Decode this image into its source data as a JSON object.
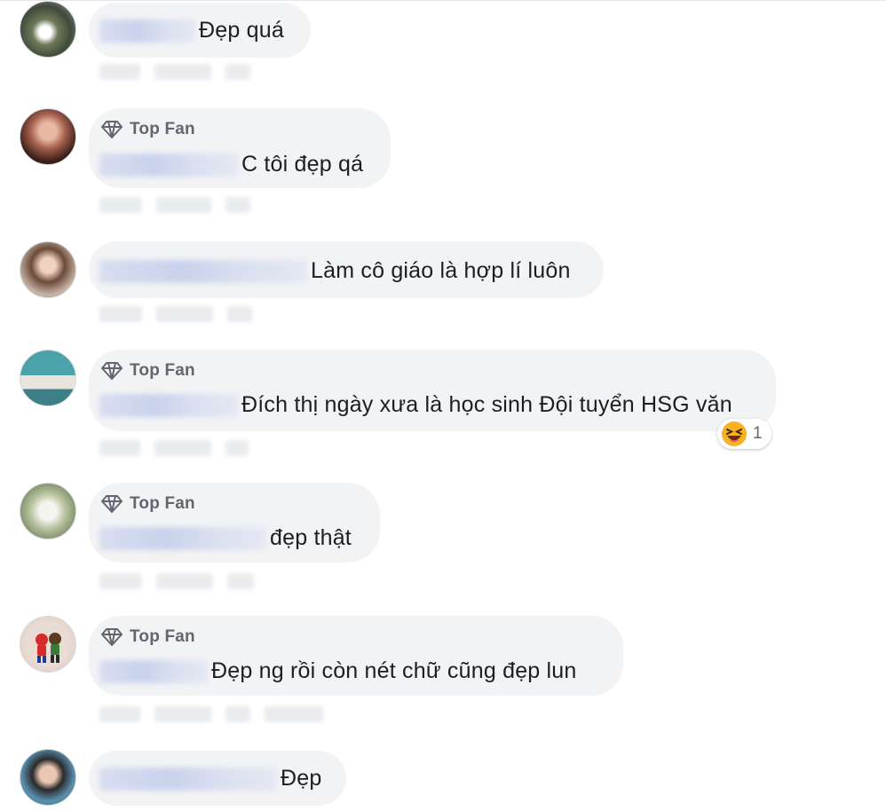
{
  "comments": [
    {
      "badge": "",
      "text": "Đẹp quá",
      "reaction_count": ""
    },
    {
      "badge": "Top Fan",
      "text": "C tôi đẹp qá",
      "reaction_count": ""
    },
    {
      "badge": "",
      "text": "Làm cô giáo là hợp lí luôn",
      "reaction_count": ""
    },
    {
      "badge": "Top Fan",
      "text": "Đích thị ngày xưa là học sinh Đội tuyển HSG văn",
      "reaction_count": "1"
    },
    {
      "badge": "Top Fan",
      "text": "đẹp thật",
      "reaction_count": ""
    },
    {
      "badge": "Top Fan",
      "text": "Đẹp ng rồi còn nét chữ cũng đẹp lun",
      "reaction_count": ""
    },
    {
      "badge": "",
      "text": "Đẹp",
      "reaction_count": ""
    }
  ],
  "colors": {
    "bubble": "#f2f3f5",
    "badge_text": "#606770",
    "reaction_face": "#f7b125"
  },
  "icons": {
    "badge": "diamond-icon",
    "reaction": "laughing-emoji-icon"
  }
}
